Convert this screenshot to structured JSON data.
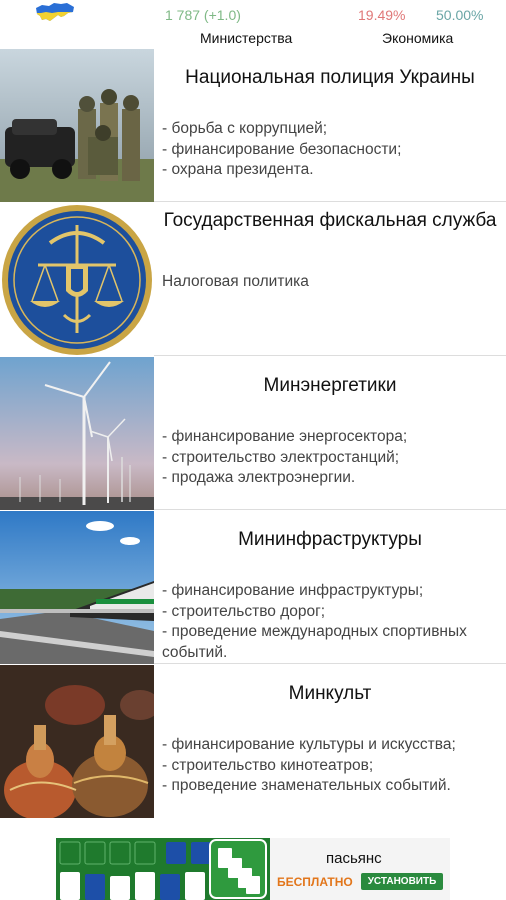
{
  "header": {
    "budget_text": "1 787  (+1.0)",
    "budget_color": "#7fb986",
    "ministries_label": "Министерства",
    "economy_left": "19.49%",
    "economy_left_color": "#e07878",
    "economy_right": "50.00%",
    "economy_right_color": "#6aa6a6",
    "economy_label": "Экономика",
    "flag_icon": "ukraine-map-flag-icon"
  },
  "ministries": [
    {
      "title": "Национальная полиция Украины",
      "description": "- борьба с коррупцией;\n- финансирование безопасности;\n- охрана президента.",
      "image": "police-photo"
    },
    {
      "title": "Государственная фискальная служба",
      "description": "Налоговая политика",
      "image": "fiscal-service-emblem"
    },
    {
      "title": "Минэнергетики",
      "description": "- финансирование энергосектора;\n- строительство электростанций;\n- продажа электроэнергии.",
      "image": "wind-turbines-photo"
    },
    {
      "title": "Мининфраструктуры",
      "description": "- финансирование инфраструктуры;\n- строительство дорог;\n- проведение международных спортивных событий.",
      "image": "train-highway-photo"
    },
    {
      "title": "Минкульт",
      "description": "- финансирование культуры и искусства;\n- строительство кинотеатров;\n- проведение знаменательных событий.",
      "image": "beaded-baskets-photo"
    }
  ],
  "ad": {
    "title": "пасьянс",
    "free_label": "БЕСПЛАТНО",
    "install_label": "УСТАНОВИТЬ",
    "image": "solitaire-cards-icon"
  }
}
